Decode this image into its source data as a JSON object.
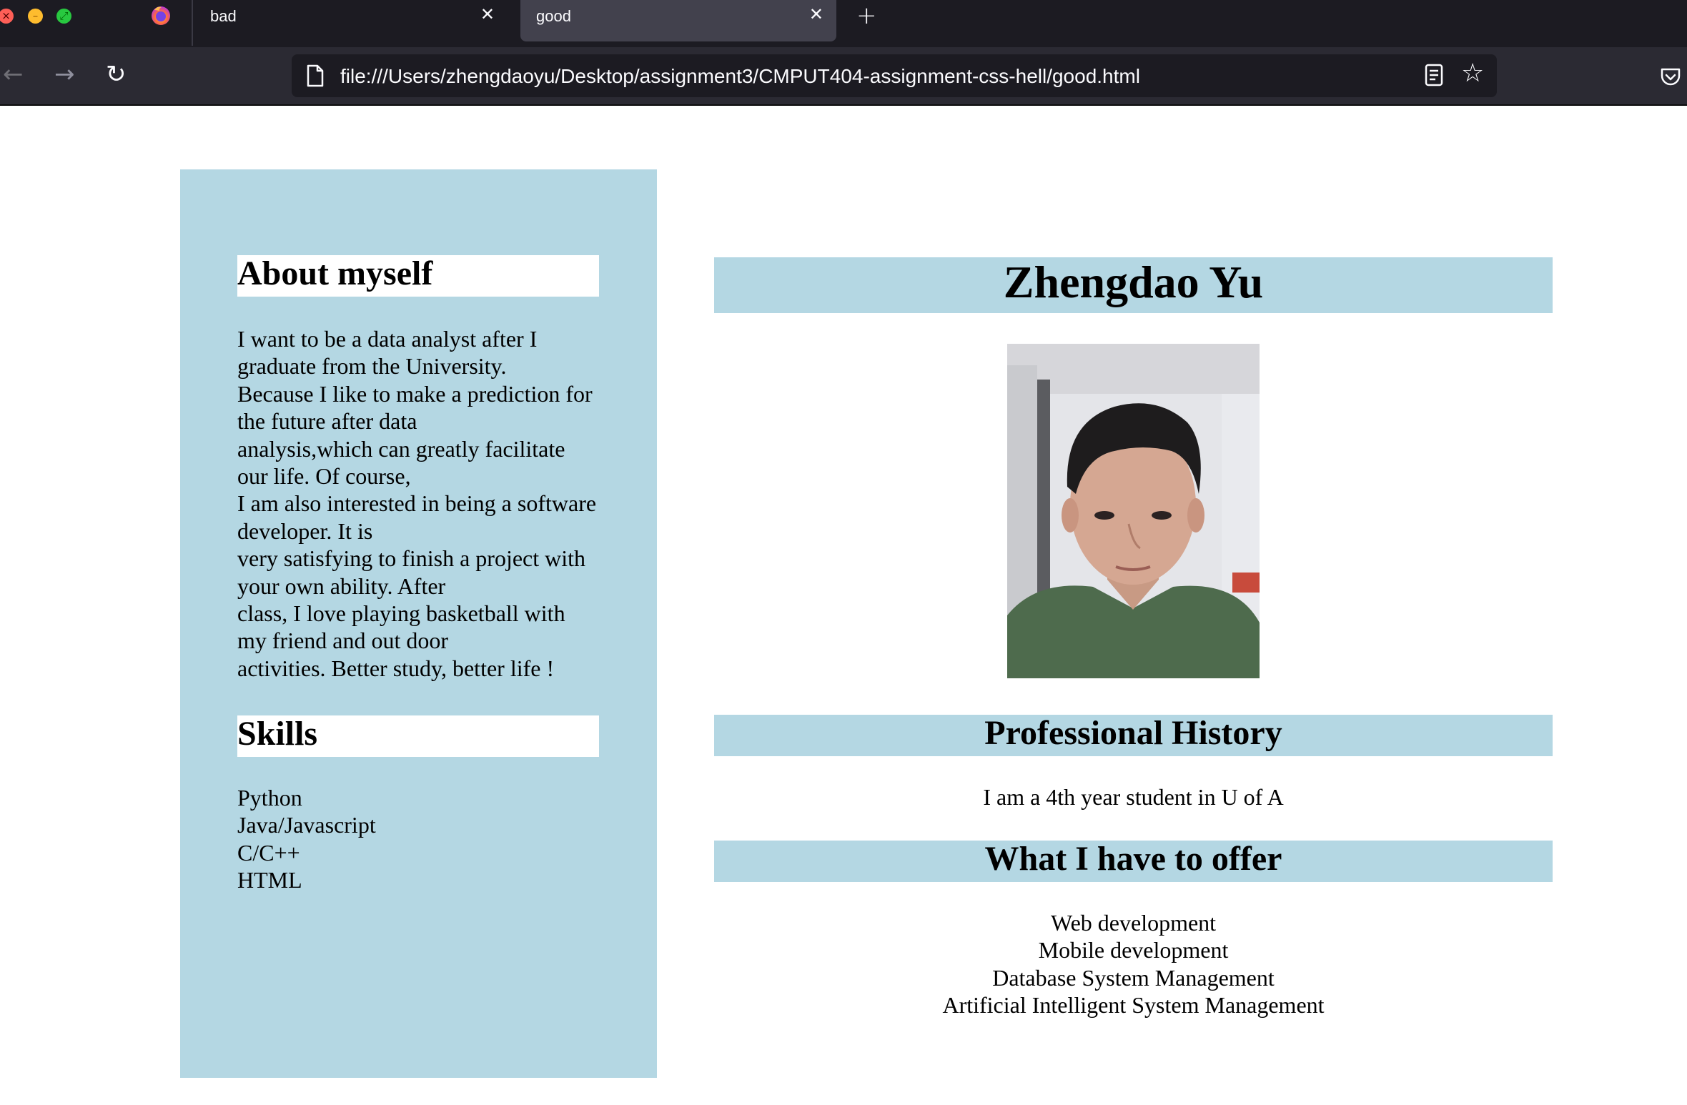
{
  "browser": {
    "tabs": [
      {
        "title": "bad",
        "active": false
      },
      {
        "title": "good",
        "active": true
      }
    ],
    "url": "file:///Users/zhengdaoyu/Desktop/assignment3/CMPUT404-assignment-css-hell/good.html"
  },
  "colors": {
    "panel": "#b4d7e3",
    "chrome_dark": "#1c1b22",
    "chrome_toolbar": "#2b2a33",
    "active_tab": "#42414d"
  },
  "sidebar": {
    "about_heading": "About myself",
    "about_lines": [
      "I want to be a data analyst after I",
      "graduate from the University.",
      "Because I like to make a prediction for",
      "the future after data",
      "analysis,which can greatly facilitate",
      "our life. Of course,",
      "I am also interested in being a software",
      "developer. It is",
      "very satisfying to finish a project with",
      "your own ability. After",
      "class, I love playing basketball with",
      "my friend and out door",
      "activities. Better study, better life !"
    ],
    "skills_heading": "Skills",
    "skills": [
      "Python",
      "Java/Javascript",
      "C/C++",
      "HTML"
    ]
  },
  "main": {
    "name": "Zhengdao Yu",
    "professional_heading": "Professional History",
    "professional_text": "I am a 4th year student in U of A",
    "offer_heading": "What I have to offer",
    "offers": [
      "Web development",
      "Mobile development",
      "Database System Management",
      "Artificial Intelligent System Management"
    ]
  }
}
